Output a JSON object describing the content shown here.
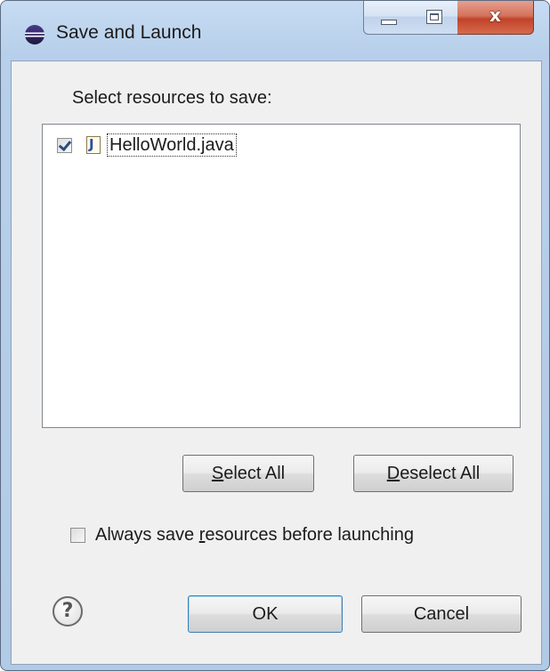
{
  "window": {
    "title": "Save and Launch",
    "icon": "eclipse-icon",
    "controls": {
      "minimize_icon": "minimize-icon",
      "maximize_icon": "maximize-icon",
      "close_glyph": "x"
    }
  },
  "prompt_label": "Select resources to save:",
  "resources": [
    {
      "name": "HelloWorld.java",
      "checked": true,
      "icon": "java-file-icon",
      "icon_glyph": "J"
    }
  ],
  "buttons": {
    "select_all": {
      "mnemonic": "S",
      "rest": "elect All"
    },
    "deselect_all": {
      "mnemonic": "D",
      "rest": "eselect All"
    },
    "ok": "OK",
    "cancel": "Cancel"
  },
  "always_save": {
    "checked": false,
    "label_before": "Always save ",
    "label_mnemonic": "r",
    "label_after": "esources before launching"
  },
  "help_glyph": "?",
  "colors": {
    "title_bar": "#b9d1ea",
    "close_button": "#c7432a",
    "client_background": "#f0f0f0",
    "default_button_border": "#3c7fb1"
  }
}
